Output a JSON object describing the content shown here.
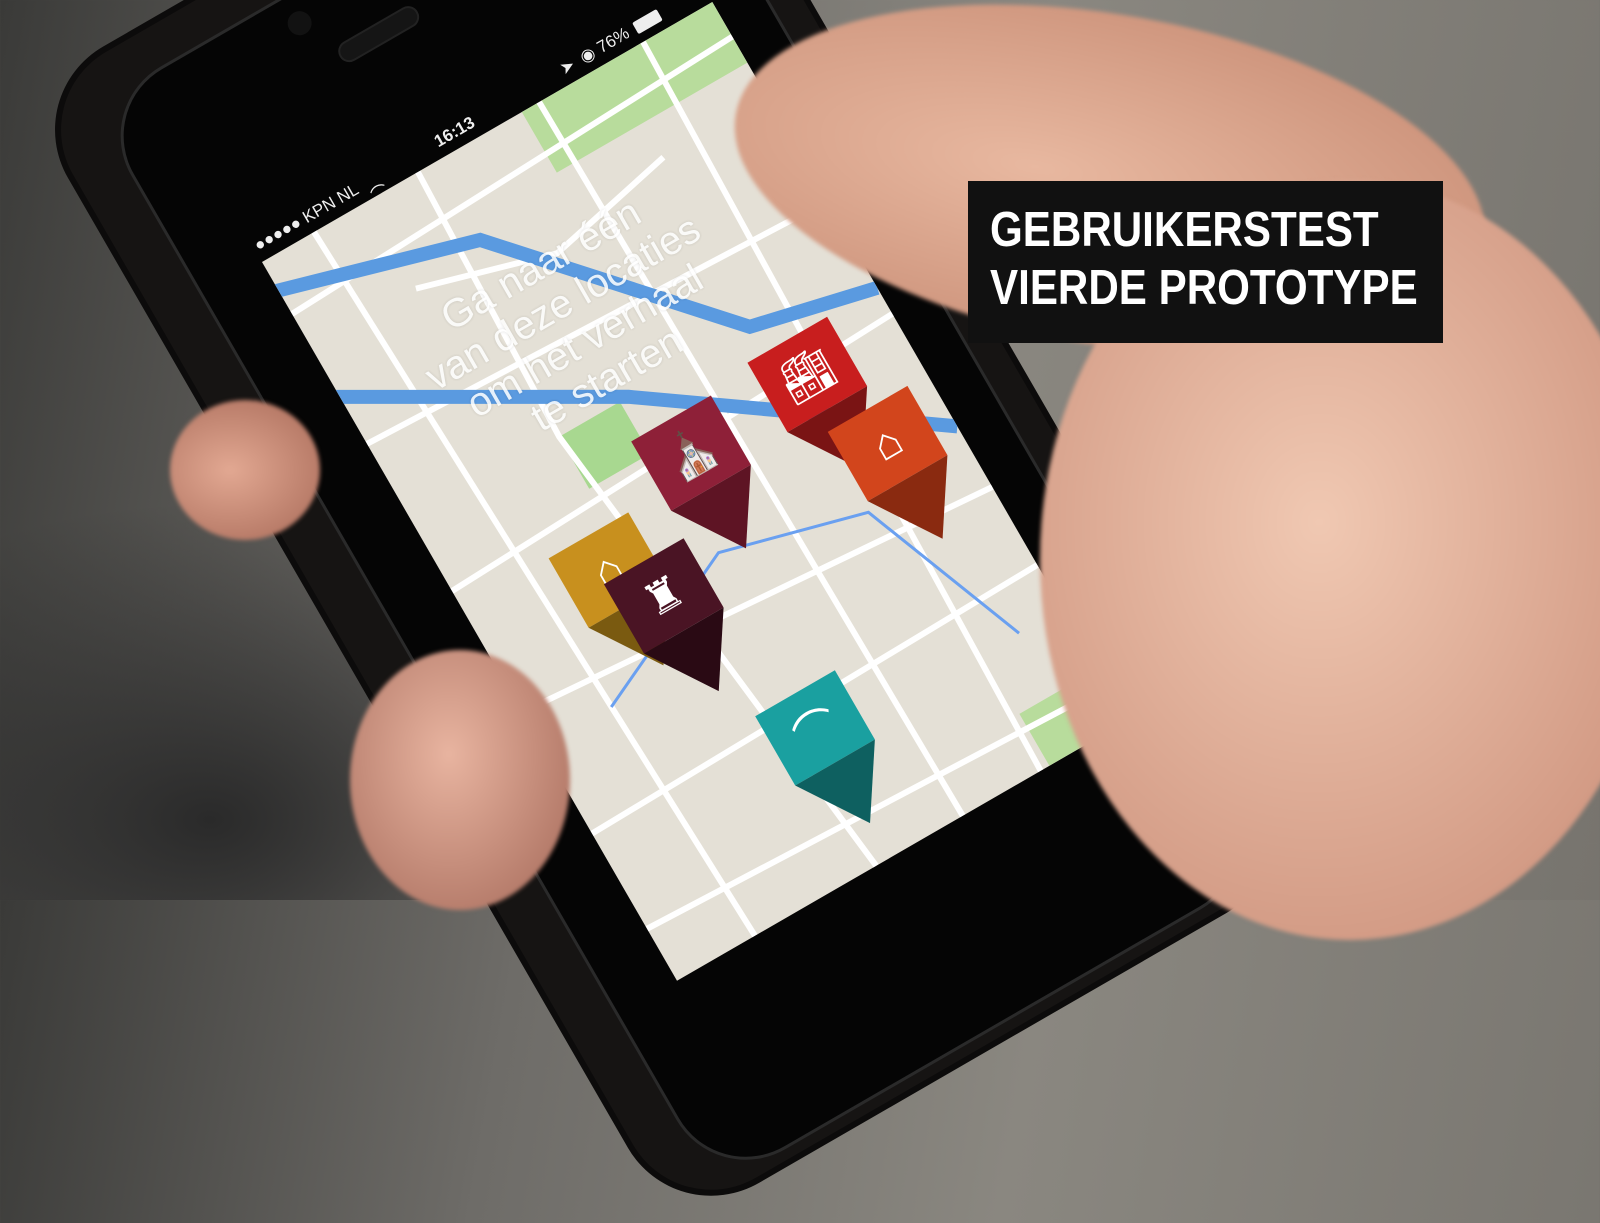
{
  "status_bar": {
    "carrier": "●●●●● KPN NL",
    "time": "16:13",
    "battery": "76%"
  },
  "map": {
    "message": [
      "Ga naar één",
      "van deze locaties",
      "om het verhaal",
      "te starten"
    ]
  },
  "pins": [
    {
      "icon": "church-icon",
      "color": "#8e2038"
    },
    {
      "icon": "factory-icon",
      "color": "#c81e1e"
    },
    {
      "icon": "house-icon",
      "color": "#d2451c"
    },
    {
      "icon": "villa-icon",
      "color": "#c8901e"
    },
    {
      "icon": "castle-icon",
      "color": "#4a1424"
    },
    {
      "icon": "bridge-icon",
      "color": "#1aa0a0"
    }
  ],
  "caption": {
    "line1": "GEBRUIKERSTEST",
    "line2": "VIERDE PROTOTYPE"
  }
}
